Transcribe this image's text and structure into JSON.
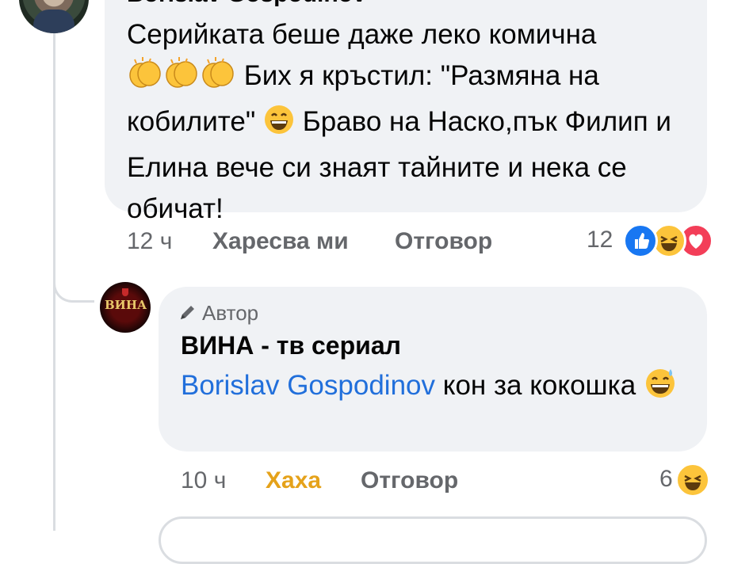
{
  "comment": {
    "author": "Borislav Gospodinov",
    "text_before_emoji": "Серийката беше даже леко комична",
    "text_middle": "Бих я кръстил: \"Размяна на кобилите\"",
    "text_after": "Браво на Наско,пък Филип и Елина вече си знаят тайните и нека се обичат!",
    "emojis": [
      "clapping-hands",
      "clapping-hands",
      "clapping-hands",
      "grinning-face"
    ],
    "time": "12 ч",
    "like_label": "Харесва ми",
    "reply_label": "Отговор",
    "reaction_count": "12",
    "reactions": [
      "like",
      "haha",
      "love"
    ]
  },
  "reply": {
    "badge": "Автор",
    "author": "ВИНА - тв сериал",
    "avatar_text": "ВИНА",
    "mention": "Borislav Gospodinov",
    "text": "кон за кокошка",
    "emoji": "grinning-sweat-face",
    "time": "10 ч",
    "reaction_label": "Хаха",
    "reply_label": "Отговор",
    "reaction_count": "6",
    "reactions": [
      "haha"
    ]
  },
  "colors": {
    "bubble": "#f0f2f5",
    "meta": "#65676b",
    "mention": "#216fdb",
    "haha_active": "#e5a21a",
    "like_blue": "#1877f2",
    "love_red": "#f33e58",
    "emoji_yellow": "#fcc43b"
  }
}
